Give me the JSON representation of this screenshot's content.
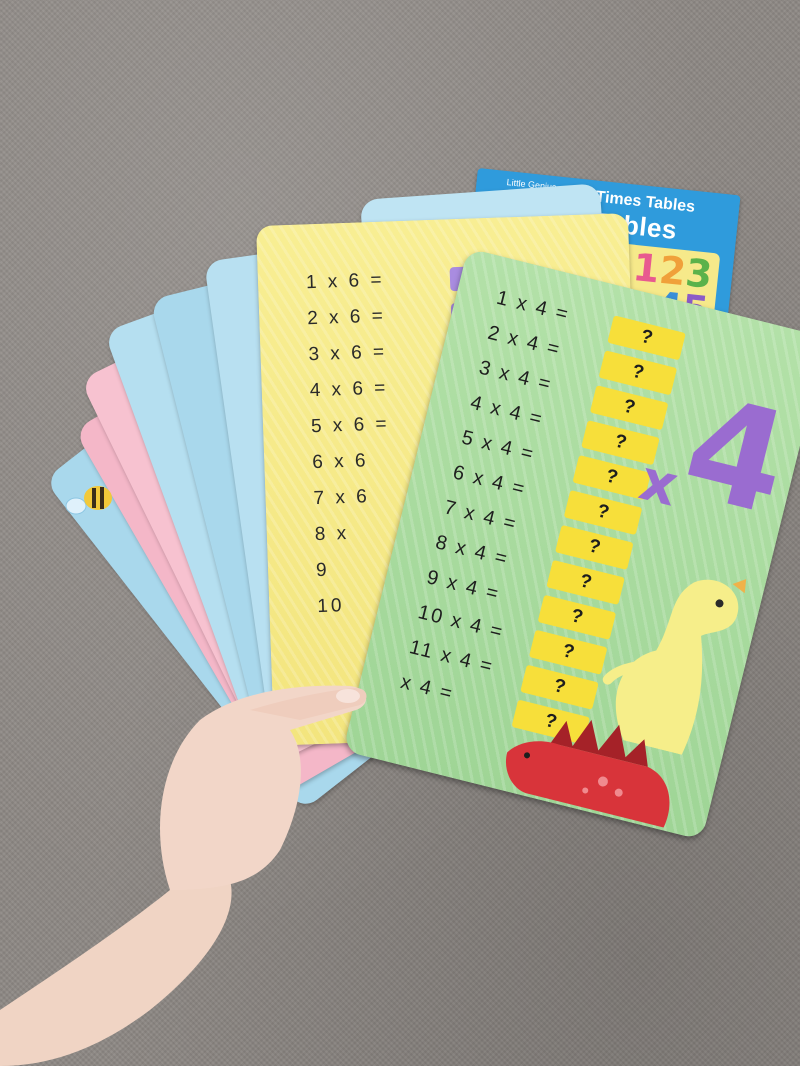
{
  "box": {
    "small_text": "Little Genius",
    "title_small": "Times Tables",
    "title": "Times Tables",
    "digits": [
      "1",
      "2",
      "3",
      "4",
      "5"
    ]
  },
  "yellow_card": {
    "rows": [
      {
        "eq": "1 x 6 =",
        "answer": "?"
      },
      {
        "eq": "2 x 6 =",
        "answer": "?"
      },
      {
        "eq": "3 x 6 =",
        "answer": "?"
      },
      {
        "eq": "4 x 6 =",
        "answer": "?"
      },
      {
        "eq": "5 x 6 =",
        "answer": "?"
      },
      {
        "eq": "6 x 6",
        "answer": ""
      },
      {
        "eq": "7 x 6",
        "answer": ""
      },
      {
        "eq": "8 x",
        "answer": ""
      },
      {
        "eq": "9",
        "answer": ""
      },
      {
        "eq": "10",
        "answer": ""
      }
    ]
  },
  "green_card": {
    "big_number": "4",
    "times_sign": "x",
    "rows": [
      {
        "eq": "1 x 4 =",
        "answer": "?"
      },
      {
        "eq": "2 x 4 =",
        "answer": "?"
      },
      {
        "eq": "3 x 4 =",
        "answer": "?"
      },
      {
        "eq": "4 x 4 =",
        "answer": "?"
      },
      {
        "eq": "5 x 4 =",
        "answer": "?"
      },
      {
        "eq": "6 x 4 =",
        "answer": "?"
      },
      {
        "eq": "7 x 4 =",
        "answer": "?"
      },
      {
        "eq": "8 x 4 =",
        "answer": "?"
      },
      {
        "eq": "9 x 4 =",
        "answer": "?"
      },
      {
        "eq": "10 x 4 =",
        "answer": "?"
      },
      {
        "eq": "11 x 4 =",
        "answer": "?"
      },
      {
        "eq": "x 4 =",
        "answer": "?"
      }
    ]
  },
  "colors": {
    "carpet": "#8d8884",
    "box_blue": "#2f9bdc",
    "card_yellow": "#f7ec8c",
    "card_green": "#a8dca0",
    "card_blue": "#a9d8ec",
    "card_pink": "#f4b7c8",
    "answer_yellow": "#f7df3a",
    "answer_purple": "#a98ce0",
    "numeral_purple": "#9a6cd0",
    "dino_yellow": "#f6ee8a",
    "dino_red": "#d8343a",
    "skin": "#f2d6c8"
  }
}
